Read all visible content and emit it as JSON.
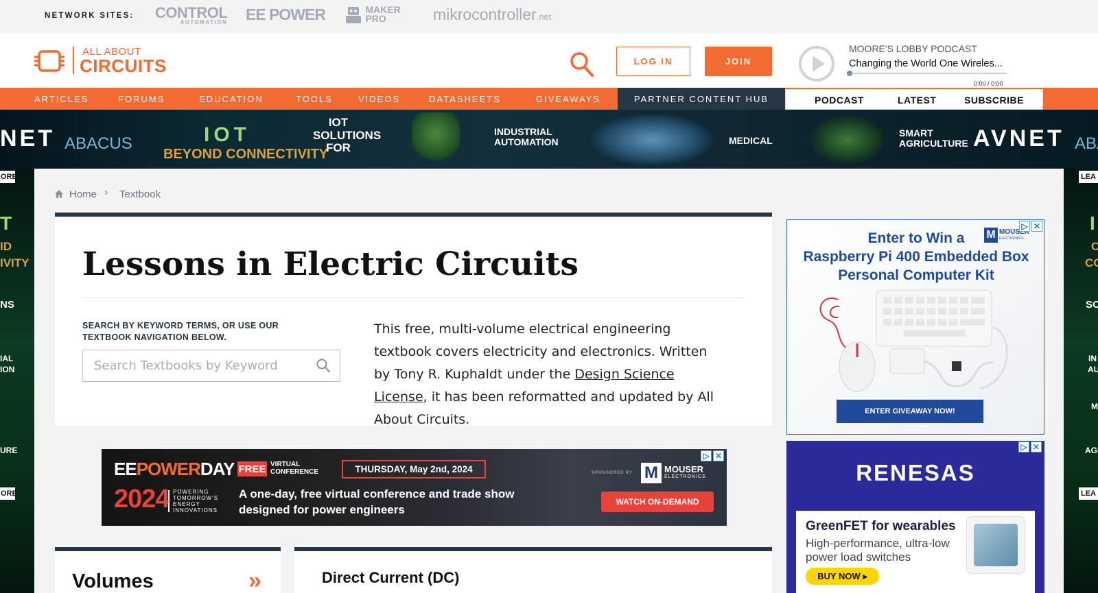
{
  "network": {
    "label": "NETWORK SITES:",
    "sites": [
      "CONTROL",
      "AUTOMATION",
      "EE POWER",
      "MAKER",
      "PRO",
      "mikrocontroller",
      ".net"
    ]
  },
  "header": {
    "logo_top": "ALL ABOUT",
    "logo_bottom": "CIRCUITS",
    "login": "LOG IN",
    "join": "JOIN",
    "podcast_label": "MOORE'S LOBBY PODCAST",
    "podcast_title": "Changing the World One Wireles...",
    "podcast_time": "0:00 / 0:00",
    "accent": "#f26b32",
    "dark": "#263645"
  },
  "nav": {
    "items": [
      "ARTICLES",
      "FORUMS",
      "EDUCATION",
      "TOOLS",
      "VIDEOS",
      "DATASHEETS",
      "GIVEAWAYS"
    ],
    "partner": "PARTNER CONTENT HUB",
    "podcast_tabs": [
      "PODCAST",
      "LATEST",
      "SUBSCRIBE"
    ]
  },
  "banner": {
    "left_brand": "NET",
    "abacus": "ABACUS",
    "iot": "IOT",
    "beyond": "BEYOND CONNECTIVITY",
    "sol1": "IOT",
    "sol2": "SOLUTIONS",
    "sol3": "FOR",
    "ind1": "INDUSTRIAL",
    "ind2": "AUTOMATION",
    "medical": "MEDICAL",
    "agri1": "SMART",
    "agri2": "AGRICULTURE",
    "right_brand": "AVNET",
    "right_abacus": "ABA"
  },
  "rails": {
    "left": [
      "ORE",
      "T",
      "ID",
      "IVITY",
      "NS",
      "IAL",
      "ION",
      "URE",
      "ORE"
    ],
    "right": [
      "LEA",
      "I",
      "C",
      "CON",
      "SO",
      "IN",
      "AU",
      "M",
      "AGI",
      "LEA"
    ]
  },
  "breadcrumb": {
    "home": "Home",
    "sep": "›",
    "current": "Textbook"
  },
  "intro": {
    "title": "Lessons in Electric Circuits",
    "search_label": "SEARCH BY KEYWORD TERMS, OR USE OUR TEXTBOOK NAVIGATION BELOW.",
    "search_placeholder": "Search Textbooks by Keyword",
    "desc_1": "This free, multi-volume electrical engineering textbook covers electricity and electronics. Written by Tony R. Kuphaldt under the ",
    "desc_link": "Design Science License",
    "desc_2": ", it has been reformatted and updated by All About Circuits."
  },
  "ad_ee": {
    "brand_ee": "EE",
    "brand_power": "POWER",
    "brand_day": "DAY",
    "year": "2024",
    "tag1": "POWERING",
    "tag2": "TOMORROW'S",
    "tag3": "ENERGY",
    "tag4": "INNOVATIONS",
    "free": "FREE",
    "virt1": "VIRTUAL",
    "virt2": "CONFERENCE",
    "date": "THURSDAY, May 2nd, 2024",
    "line1": "A one-day, free virtual conference and trade show",
    "line2": "designed for power engineers",
    "sponsored": "SPONSORED BY",
    "mouser": "MOUSER",
    "mouser_sub": "ELECTRONICS",
    "cta": "WATCH ON-DEMAND"
  },
  "ad_rpi": {
    "line1": "Enter to Win a",
    "line2": "Raspberry Pi 400 Embedded Box",
    "line3": "Personal Computer Kit",
    "mouser": "MOUSER",
    "mouser_sub": "ELECTRONICS",
    "cta": "ENTER GIVEAWAY NOW!"
  },
  "ad_renesas": {
    "brand": "RENESAS",
    "title": "GreenFET for wearables",
    "sub1": "High-performance, ultra-low",
    "sub2": "power load switches",
    "cta": "BUY NOW ▸"
  },
  "cards": {
    "volumes": "Volumes",
    "volumes_arrow": "»",
    "dc": "Direct Current (DC)"
  },
  "ad_close": "✕",
  "ad_choice": "▷"
}
